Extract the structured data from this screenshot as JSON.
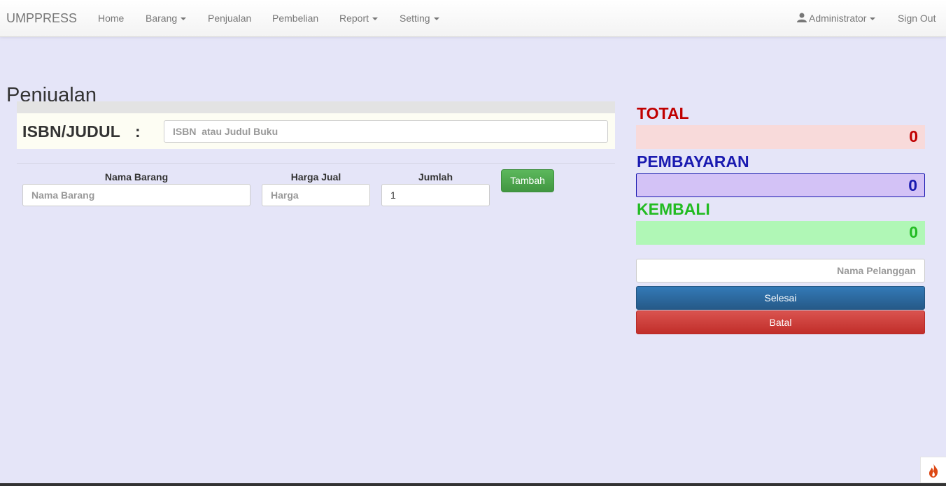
{
  "navbar": {
    "brand": "UMPPRESS",
    "items": [
      {
        "label": "Home",
        "dropdown": false
      },
      {
        "label": "Barang",
        "dropdown": true
      },
      {
        "label": "Penjualan",
        "dropdown": false
      },
      {
        "label": "Pembelian",
        "dropdown": false
      },
      {
        "label": "Report",
        "dropdown": true
      },
      {
        "label": "Setting",
        "dropdown": true
      }
    ],
    "user_label": "Administrator",
    "signout_label": "Sign Out"
  },
  "page": {
    "title": "Penjualan"
  },
  "search": {
    "label": "ISBN/JUDUL",
    "colon": ":",
    "placeholder": "ISBN  atau Judul Buku",
    "value": ""
  },
  "item_form": {
    "nama_label": "Nama Barang",
    "nama_placeholder": "Nama Barang",
    "harga_label": "Harga Jual",
    "harga_placeholder": "Harga",
    "jumlah_label": "Jumlah",
    "jumlah_value": "1",
    "add_button": "Tambah"
  },
  "summary": {
    "total_label": "TOTAL",
    "total_value": "0",
    "pembayaran_label": "PEMBAYARAN",
    "pembayaran_value": "0",
    "kembali_label": "KEMBALI",
    "kembali_value": "0",
    "pelanggan_placeholder": "Nama Pelanggan",
    "selesai_button": "Selesai",
    "batal_button": "Batal"
  },
  "colors": {
    "total": "#c00000",
    "total_bg": "#f8dada",
    "pembayaran": "#1a1ab0",
    "pembayaran_bg": "#d3c2f6",
    "kembali": "#22bb22",
    "kembali_bg": "#b0f7b6",
    "accent_primary": "#2e6da4",
    "accent_danger": "#c9302c",
    "accent_success": "#4cae4c"
  },
  "icons": {
    "user": "user-icon",
    "codeigniter": "flame-icon"
  }
}
